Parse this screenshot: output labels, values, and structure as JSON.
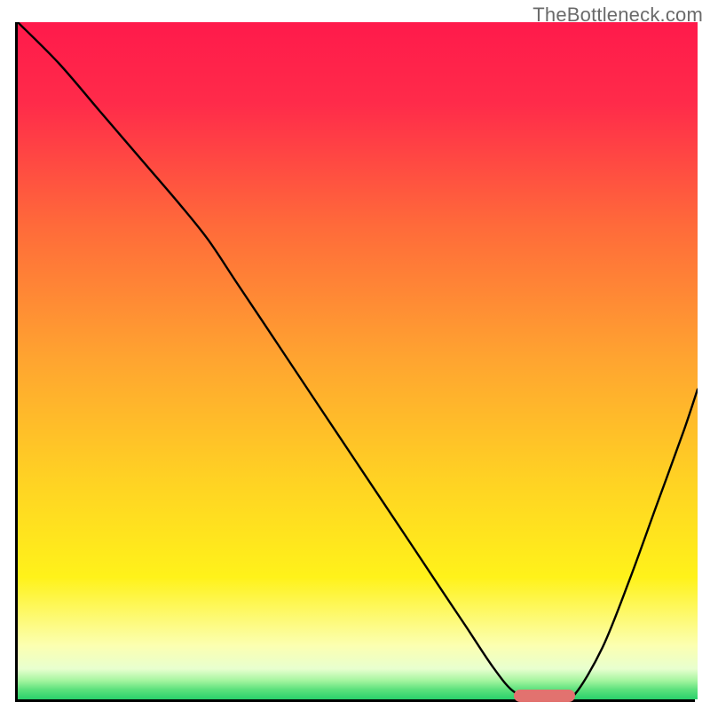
{
  "watermark": "TheBottleneck.com",
  "chart_data": {
    "type": "line",
    "title": "",
    "xlabel": "",
    "ylabel": "",
    "x_range": [
      0,
      100
    ],
    "y_range": [
      0,
      100
    ],
    "axes": {
      "left_axis_visible": true,
      "bottom_axis_visible": true,
      "ticks_visible": false,
      "grid": false
    },
    "background_gradient": {
      "type": "vertical-smooth",
      "description": "red at top through orange, yellow, pale-yellow, then narrow green band at bottom",
      "stops": [
        {
          "pos": 0.0,
          "color": "#ff1a4b"
        },
        {
          "pos": 0.12,
          "color": "#ff2b4a"
        },
        {
          "pos": 0.3,
          "color": "#ff6a3a"
        },
        {
          "pos": 0.5,
          "color": "#ffa530"
        },
        {
          "pos": 0.68,
          "color": "#ffd323"
        },
        {
          "pos": 0.82,
          "color": "#fff21a"
        },
        {
          "pos": 0.92,
          "color": "#fcffb0"
        },
        {
          "pos": 0.955,
          "color": "#e8ffcf"
        },
        {
          "pos": 0.972,
          "color": "#a6f5a0"
        },
        {
          "pos": 0.985,
          "color": "#5fe27e"
        },
        {
          "pos": 1.0,
          "color": "#29d06b"
        }
      ]
    },
    "series": [
      {
        "name": "bottleneck-curve",
        "color": "#000000",
        "stroke_width": 2.4,
        "x": [
          0,
          6,
          12,
          18,
          24,
          28,
          32,
          38,
          44,
          50,
          56,
          62,
          66,
          70,
          73,
          76,
          80,
          82,
          86,
          90,
          94,
          98,
          100
        ],
        "y": [
          100,
          94,
          87,
          80,
          73,
          68,
          62,
          53,
          44,
          35,
          26,
          17,
          11,
          5,
          1.5,
          0.8,
          0.8,
          1.2,
          8,
          18,
          29,
          40,
          46
        ]
      }
    ],
    "optimal_marker": {
      "description": "short rounded pink bar at curve minimum on x-axis",
      "x_start": 73,
      "x_end": 82,
      "y": 0.9,
      "color": "#e2726f"
    }
  }
}
